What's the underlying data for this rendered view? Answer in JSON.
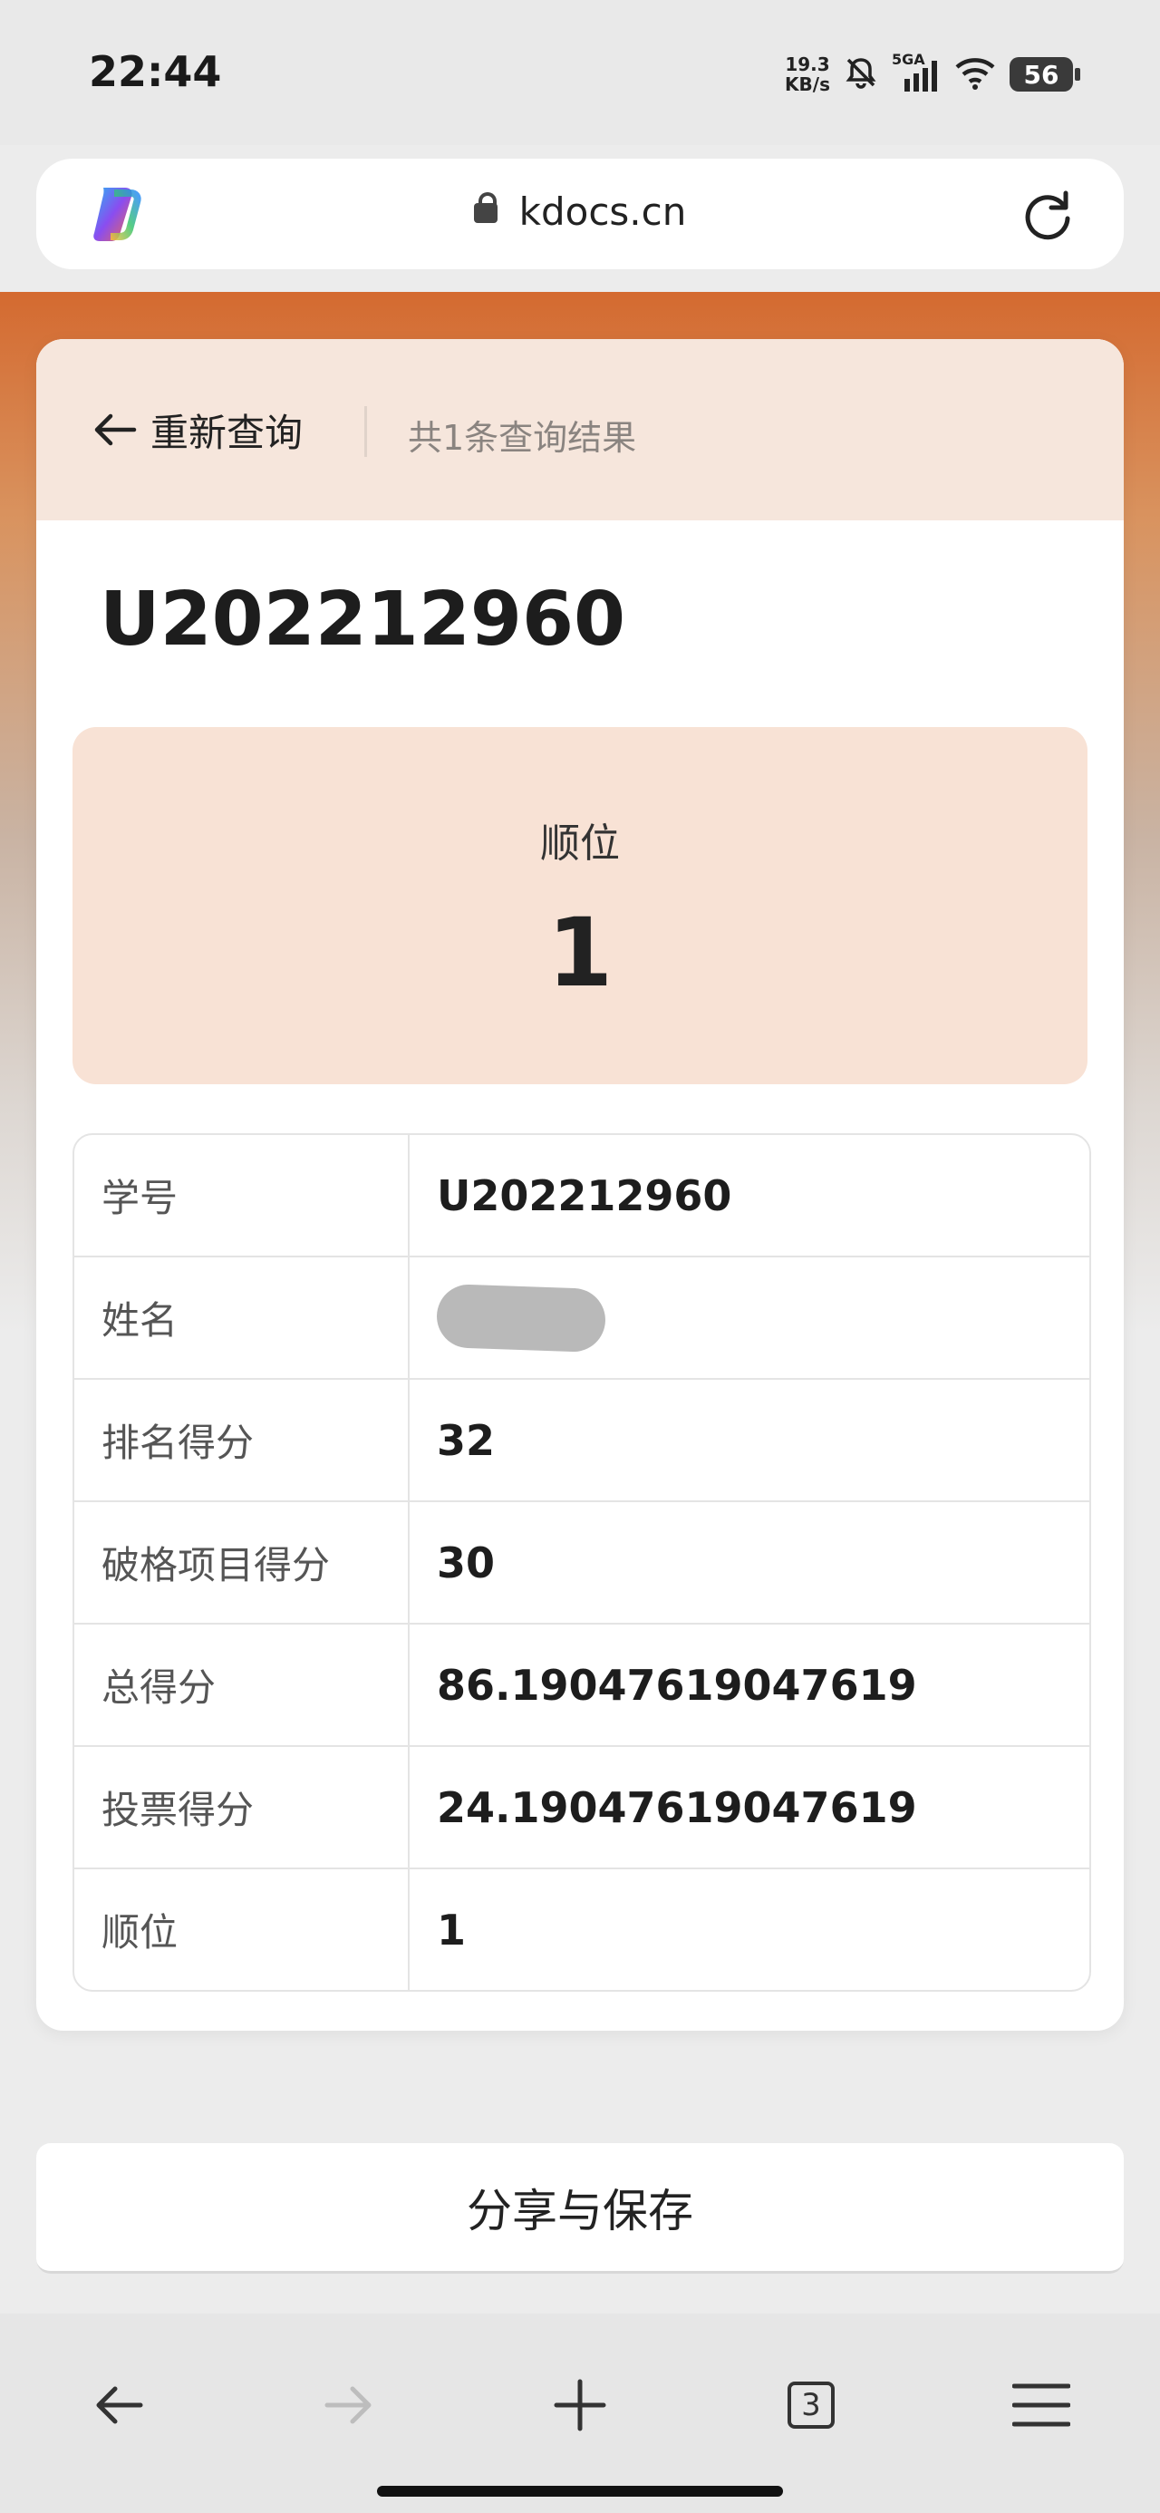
{
  "status_bar": {
    "time": "22:44",
    "net_speed_value": "19.3",
    "net_speed_unit": "KB/s",
    "network": "5GA",
    "battery": "56",
    "icons": [
      "mute-icon",
      "signal-icon",
      "wifi-icon",
      "battery-icon"
    ]
  },
  "browser": {
    "url": "kdocs.cn",
    "icons": [
      "copilot-logo",
      "lock-icon",
      "reload-icon"
    ]
  },
  "result": {
    "back_label": "重新查询",
    "count_label": "共1条查询结果",
    "record_id": "U202212960",
    "rank_label": "顺位",
    "rank_value": "1",
    "rows": [
      {
        "label": "学号",
        "value": "U202212960"
      },
      {
        "label": "姓名",
        "value": ""
      },
      {
        "label": "排名得分",
        "value": "32"
      },
      {
        "label": "破格项目得分",
        "value": "30"
      },
      {
        "label": "总得分",
        "value": "86.19047619047619"
      },
      {
        "label": "投票得分",
        "value": "24.19047619047619"
      },
      {
        "label": "顺位",
        "value": "1"
      }
    ],
    "share_label": "分享与保存"
  },
  "bottom_nav": {
    "tab_count": "3",
    "icons": [
      "back-arrow-icon",
      "forward-arrow-icon",
      "plus-icon",
      "tabs-icon",
      "menu-icon"
    ]
  },
  "colors": {
    "accent_orange": "#d46a30",
    "header_peach": "#f6e6dc",
    "rank_peach": "#f8e2d5"
  }
}
